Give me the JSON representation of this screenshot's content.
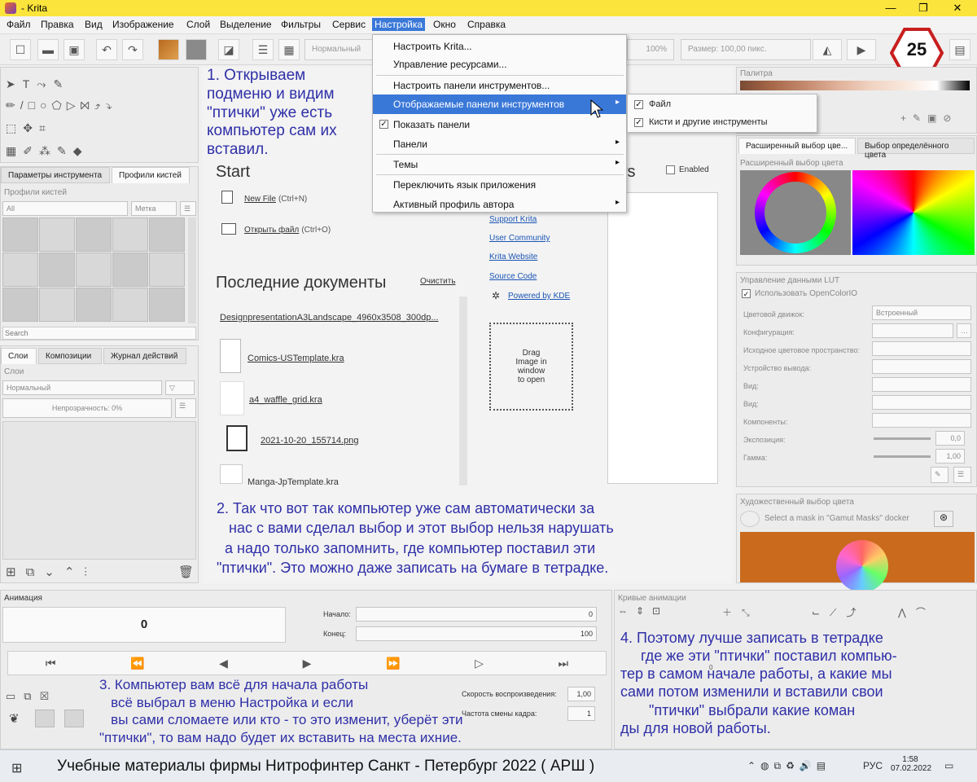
{
  "window": {
    "title": "- Krita",
    "controls": {
      "minimize": "—",
      "maximize": "❐",
      "close": "✕"
    }
  },
  "menubar": {
    "items": [
      "Файл",
      "Правка",
      "Вид",
      "Изображение",
      "Слой",
      "Выделение",
      "Фильтры",
      "Сервис",
      "Настройка",
      "Окно",
      "Справка"
    ],
    "active": "Настройка"
  },
  "toolbar": {
    "blend_mode": "Нормальный",
    "opacity": "100%",
    "size": "Размер: 100,00 пикс."
  },
  "badge": {
    "number": "25"
  },
  "settings_menu": {
    "items": [
      {
        "label": "Настроить Krita...",
        "arrow": false
      },
      {
        "label": "Управление ресурсами...",
        "arrow": false
      },
      {
        "label": "Настроить панели инструментов...",
        "arrow": false
      },
      {
        "label": "Отображаемые панели инструментов",
        "arrow": true,
        "highlighted": true
      },
      {
        "label": "Показать панели",
        "checked": true,
        "arrow": false
      },
      {
        "label": "Панели",
        "arrow": true
      },
      {
        "label": "Темы",
        "arrow": true
      },
      {
        "label": "Переключить язык приложения",
        "arrow": false
      },
      {
        "label": "Активный профиль автора",
        "arrow": true
      }
    ]
  },
  "submenu": {
    "items": [
      {
        "label": "Файл",
        "checked": true
      },
      {
        "label": "Кисти и другие инструменты",
        "checked": true
      }
    ]
  },
  "left_dock": {
    "tabs": [
      "Параметры инструмента",
      "Профили кистей"
    ],
    "brush_presets_title": "Профили кистей",
    "brush_filter": "All",
    "brush_tag": "Метка",
    "search_placeholder": "Search",
    "layer_tabs": [
      "Слои",
      "Композиции",
      "Журнал действий"
    ],
    "layers_title": "Слои",
    "layers_blend": "Нормальный",
    "layers_opacity": "Непрозрачность:  0%"
  },
  "welcome": {
    "start_title": "Start",
    "new_file": "New File",
    "new_file_shortcut": "(Ctrl+N)",
    "open_file": "Открыть файл",
    "open_file_shortcut": "(Ctrl+O)",
    "recent_title": "Последние документы",
    "clear": "Очистить",
    "recent_files": [
      "DesignpresentationA3Landscape_4960x3508_300dp...",
      "Comics-USTemplate.kra",
      "a4_waffle_grid.kra",
      "2021-10-20_155714.png",
      "Manga-JpTemplate.kra"
    ],
    "links": [
      "Support Krita",
      "User Community",
      "Krita Website",
      "Source Code",
      "Powered by KDE"
    ],
    "news_title": "ws",
    "news_enabled": "Enabled",
    "drag_text": "Drag\nImage in\nwindow\nto open"
  },
  "right_dock": {
    "palette_title": "Палитра",
    "color_tabs": [
      "Расширенный выбор цве...",
      "Выбор определённого цвета"
    ],
    "advanced_title": "Расширенный выбор цвета",
    "lut_title": "Управление данными LUT",
    "use_ocio": "Использовать OpenColorIO",
    "lut_rows": [
      {
        "label": "Цветовой движок:",
        "value": "Встроенный"
      },
      {
        "label": "Конфигурация:",
        "value": ""
      },
      {
        "label": "Исходное цветовое пространство:",
        "value": ""
      },
      {
        "label": "Устройство вывода:",
        "value": ""
      },
      {
        "label": "Вид:",
        "value": ""
      },
      {
        "label": "Вид:",
        "value": ""
      },
      {
        "label": "Компоненты:",
        "value": ""
      },
      {
        "label": "Экспозиция:",
        "value": "0,0"
      },
      {
        "label": "Гамма:",
        "value": "1,00"
      }
    ],
    "artistic_title": "Художественный выбор цвета",
    "gamut_hint": "Select a mask in \"Gamut Masks\" docker"
  },
  "animation": {
    "title": "Анимация",
    "frame": "0",
    "start_label": "Начало:",
    "start_value": "0",
    "end_label": "Конец:",
    "end_value": "100",
    "speed_label": "Скорость воспроизведения:",
    "speed_value": "1,00",
    "rate_label": "Частота смены кадра:",
    "rate_value": "1",
    "curves_title": "Кривые анимации",
    "curves_val": "0"
  },
  "notes": {
    "n1": "1. Открываем\nподменю и видим\n\"птички\" уже есть\nкомпьютер сам их\nвставил.",
    "n2": "2. Так что вот так компьютер уже сам автоматически за\n   нас с вами сделал выбор и этот выбор нельзя нарушать\n  а надо только запомнить, где компьютер поставил эти\n\"птички\". Это можно даже записать на бумаге в тетрадке.",
    "n3": "3. Компьютер вам всё для начала работы\n   всё выбрал в меню Настройка и если\n   вы сами сломаете или кто - то это изменит, уберёт эти\n\"птички\", то вам надо будет их вставить на места ихние.",
    "n4": "4. Поэтому лучше записать в тетрадке\n     где же эти \"птички\" поставил компью-\nтер в самом начале работы, а какие мы\nсами потом изменили и вставили свои\n       \"птички\" выбрали какие коман\nды для новой работы."
  },
  "taskbar": {
    "caption": "Учебные материалы фирмы Нитрофинтер Санкт - Петербург  2022 ( АРШ )",
    "lang": "РУС",
    "time": "1:58",
    "date": "07.02.2022"
  }
}
